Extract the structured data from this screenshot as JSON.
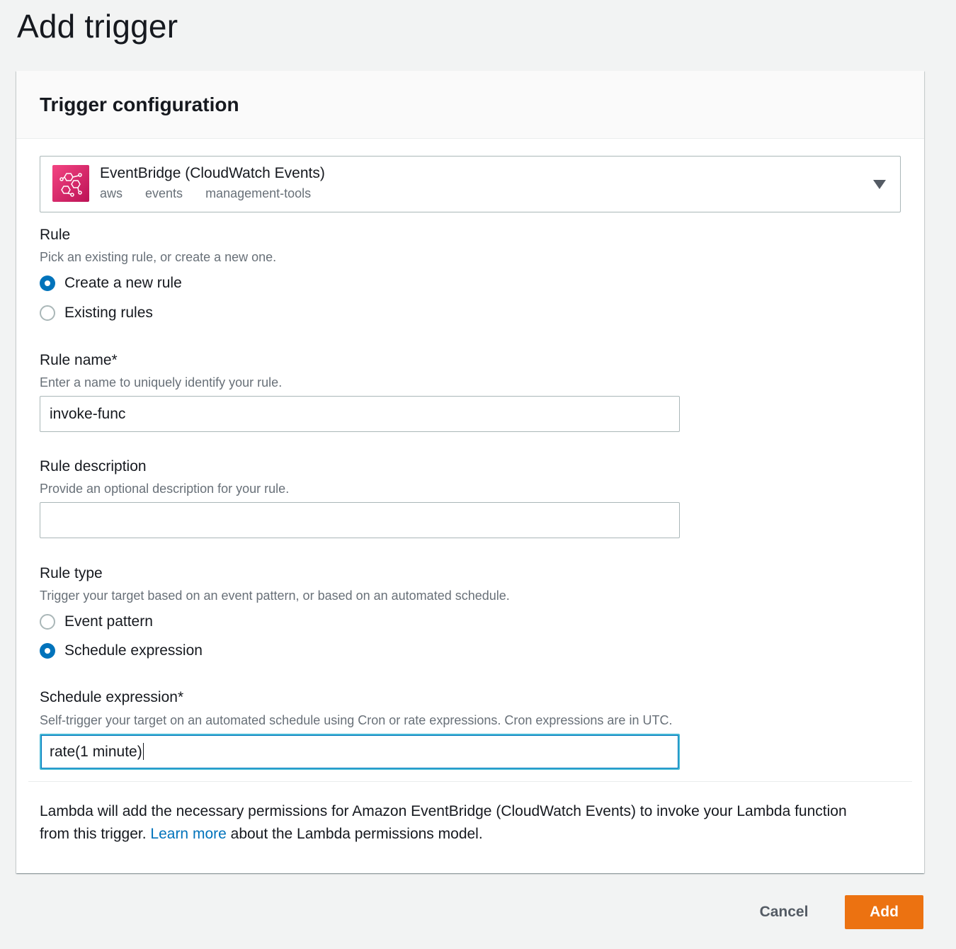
{
  "page": {
    "title": "Add trigger"
  },
  "card": {
    "title": "Trigger configuration"
  },
  "source": {
    "name": "EventBridge (CloudWatch Events)",
    "tags": [
      "aws",
      "events",
      "management-tools"
    ],
    "icon": "eventbridge-icon",
    "icon_color": "#d6245e"
  },
  "rule": {
    "label": "Rule",
    "description": "Pick an existing rule, or create a new one.",
    "options": [
      {
        "label": "Create a new rule",
        "checked": true
      },
      {
        "label": "Existing rules",
        "checked": false
      }
    ]
  },
  "rule_name": {
    "label": "Rule name*",
    "description": "Enter a name to uniquely identify your rule.",
    "value": "invoke-func"
  },
  "rule_description": {
    "label": "Rule description",
    "description": "Provide an optional description for your rule.",
    "value": ""
  },
  "rule_type": {
    "label": "Rule type",
    "description": "Trigger your target based on an event pattern, or based on an automated schedule.",
    "options": [
      {
        "label": "Event pattern",
        "checked": false
      },
      {
        "label": "Schedule expression",
        "checked": true
      }
    ]
  },
  "schedule_expression": {
    "label": "Schedule expression*",
    "description": "Self-trigger your target on an automated schedule using Cron or rate expressions. Cron expressions are in UTC.",
    "value": "rate(1 minute)"
  },
  "permissions_note": {
    "before": "Lambda will add the necessary permissions for Amazon EventBridge (CloudWatch Events) to invoke your Lambda function from this trigger.",
    "link": "Learn more",
    "after": "about the Lambda permissions model."
  },
  "actions": {
    "cancel_label": "Cancel",
    "add_label": "Add",
    "primary_color": "#ec7211",
    "link_color": "#0073bb"
  }
}
